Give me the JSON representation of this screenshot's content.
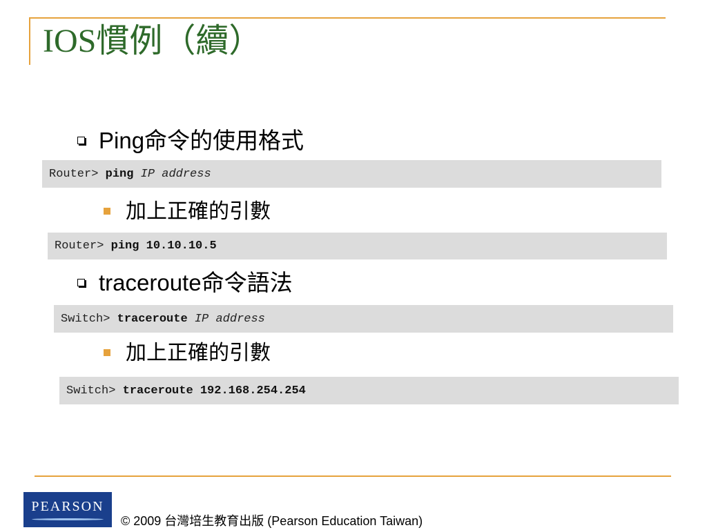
{
  "title": "IOS慣例（續）",
  "items": [
    {
      "label": "Ping命令的使用格式",
      "syntax": {
        "prompt": "Router> ",
        "command": "ping",
        "argument": " IP address"
      },
      "sub_label": "加上正確的引數",
      "example": {
        "prompt": "Router> ",
        "command": "ping 10.10.10.5"
      }
    },
    {
      "label": "traceroute命令語法",
      "syntax": {
        "prompt": "Switch> ",
        "command": "traceroute",
        "argument": " IP address"
      },
      "sub_label": "加上正確的引數",
      "example": {
        "prompt": "Switch> ",
        "command": "traceroute 192.168.254.254"
      }
    }
  ],
  "footer": {
    "logo_text": "PEARSON",
    "copyright": "© 2009 台灣培生教育出版 (Pearson Education Taiwan)"
  },
  "colors": {
    "accent": "#e6a23c",
    "title": "#2e6a2a",
    "code_background": "#dcdcdc",
    "logo_background": "#1a3f8c"
  }
}
